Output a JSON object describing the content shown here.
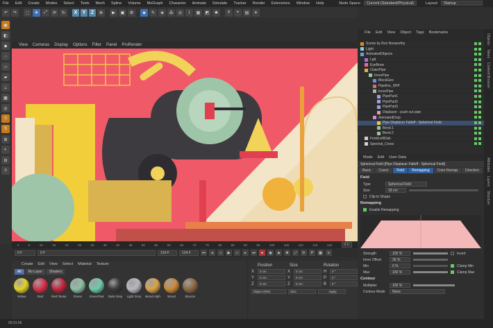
{
  "menubar": {
    "items": [
      "File",
      "Edit",
      "Create",
      "Modes",
      "Select",
      "Tools",
      "Mesh",
      "Spline",
      "Volume",
      "MoGraph",
      "Character",
      "Animate",
      "Simulate",
      "Tracker",
      "Render",
      "Extensions",
      "Window",
      "Help"
    ],
    "node_space_label": "Node Space:",
    "node_space_value": "Current (Standard/Physical)",
    "layout_label": "Layout:",
    "layout_value": "Startup"
  },
  "toolbar": {
    "x": "X",
    "y": "Y",
    "z": "Z"
  },
  "viewport_menu": [
    "View",
    "Cameras",
    "Display",
    "Options",
    "Filter",
    "Panel",
    "ProRender"
  ],
  "timeline": {
    "ticks": [
      "0",
      "5",
      "10",
      "15",
      "20",
      "25",
      "30",
      "35",
      "40",
      "45",
      "50",
      "55",
      "60",
      "65",
      "70",
      "75",
      "80",
      "85",
      "90",
      "95",
      "100",
      "105",
      "110",
      "115",
      "120"
    ],
    "end_frame": "0 F",
    "start": "0 F",
    "current": "0 F",
    "max1": "124 F",
    "max2": "124 F"
  },
  "materials": {
    "menu": [
      "Create",
      "Edit",
      "View",
      "Select",
      "Material",
      "Texture"
    ],
    "tabs": [
      "All",
      "No Layer",
      "Shaders"
    ],
    "items": [
      {
        "name": "Yellow",
        "color": "#e5d12a"
      },
      {
        "name": "Red",
        "color": "#d8324c"
      },
      {
        "name": "Red Textur",
        "color": "#c4263e"
      },
      {
        "name": "Green",
        "color": "#8fbfa4"
      },
      {
        "name": "GreenTeal",
        "color": "#6fcaa8"
      },
      {
        "name": "Dark Grey",
        "color": "#3a3a3a"
      },
      {
        "name": "Light Grey",
        "color": "#b7b7c0"
      },
      {
        "name": "Wood Alph",
        "color": "#d8a24a"
      },
      {
        "name": "Wood",
        "color": "#c98a3a"
      },
      {
        "name": "Bronze",
        "color": "#8e6a44"
      }
    ]
  },
  "coords": {
    "position": "Position",
    "size": "Size",
    "rotation": "Rotation",
    "rows": [
      {
        "axis": "X",
        "pos": "0 cm",
        "size": "0 cm",
        "rot_label": "H",
        "rot": "0 °"
      },
      {
        "axis": "Y",
        "pos": "0 cm",
        "size": "0 cm",
        "rot_label": "P",
        "rot": "0 °"
      },
      {
        "axis": "Z",
        "pos": "0 cm",
        "size": "0 cm",
        "rot_label": "B",
        "rot": "0 °"
      }
    ],
    "object_mode": "Object (Rel)",
    "size_mode": "Size",
    "apply": "Apply"
  },
  "status": {
    "time": "00:01:56"
  },
  "objects": {
    "menu": [
      "File",
      "Edit",
      "View",
      "Object",
      "Tags",
      "Bookmarks"
    ],
    "rows": [
      {
        "name": "Scene by Ron Nosworthy",
        "indent": 0,
        "color": "#e08a2a"
      },
      {
        "name": "Light",
        "indent": 0,
        "color": "#8fd0e0"
      },
      {
        "name": "AnimatedObjects",
        "indent": 0,
        "color": "#6aa0e0"
      },
      {
        "name": "Lgd",
        "indent": 1,
        "color": "#b06adf"
      },
      {
        "name": "EyeBrow",
        "indent": 1,
        "color": "#e070a0"
      },
      {
        "name": "OuterPipe",
        "indent": 1,
        "color": "#e0b040"
      },
      {
        "name": "InnerPipe",
        "indent": 2,
        "color": "#8ad0a0"
      },
      {
        "name": "BlockGeo",
        "indent": 3,
        "color": "#6a90e0"
      },
      {
        "name": "Pipeline_SHP",
        "indent": 3,
        "color": "#e06a6a"
      },
      {
        "name": "InnerPipe",
        "indent": 3,
        "color": "#b0b0b0"
      },
      {
        "name": "PipePart1",
        "indent": 4,
        "color": "#a0a0e0"
      },
      {
        "name": "PipePart2",
        "indent": 4,
        "color": "#a0a0e0"
      },
      {
        "name": "PipePart3",
        "indent": 4,
        "color": "#a0a0e0"
      },
      {
        "name": "Displacer - push out pipe",
        "indent": 4,
        "color": "#e0a0a0"
      },
      {
        "name": "AnimatedDrop",
        "indent": 3,
        "color": "#d08ae0"
      },
      {
        "name": "Pipe Displacer Falloff - Spherical Field",
        "indent": 4,
        "color": "#e0d040"
      },
      {
        "name": "Bend.1",
        "indent": 4,
        "color": "#a0c0a0"
      },
      {
        "name": "Bend.2",
        "indent": 4,
        "color": "#a0c0a0"
      },
      {
        "name": "FrontLeftDisk",
        "indent": 1,
        "color": "#d0d0d0"
      },
      {
        "name": "Spectral_Cross",
        "indent": 1,
        "color": "#d0d0d0"
      }
    ]
  },
  "attributes": {
    "menu": [
      "Mode",
      "Edit",
      "User Data"
    ],
    "title": "Spherical Field [Pipe Displacer Falloff - Spherical Field]",
    "tabs": [
      "Basic",
      "Coord.",
      "Field",
      "Remapping",
      "Color Remap",
      "Direction"
    ],
    "field_section": "Field",
    "type_label": "Type",
    "type_value": "Spherical Field",
    "size_label": "Size",
    "size_value": "18 cm",
    "clip_label": "Clip to Shape",
    "remap_section": "Remapping",
    "enable_remap": "Enable Remapping",
    "strength_label": "Strength",
    "strength_value": "100 %",
    "invert": "Invert",
    "inner_label": "Inner Offset",
    "inner_value": "36 %",
    "min_label": "Min",
    "min_value": "0 %",
    "clamp_min": "Clamp Min",
    "max_label": "Max",
    "max_value": "100 %",
    "clamp_max": "Clamp Max",
    "contour_section": "Contour",
    "multiplier_label": "Multiplier",
    "multiplier_value": "100 %",
    "contour_mode_label": "Contour Mode",
    "contour_mode_value": "None"
  },
  "side_tabs": [
    "Objects",
    "Takes",
    "Content Browser",
    "Attributes",
    "Layers",
    "Structure"
  ]
}
